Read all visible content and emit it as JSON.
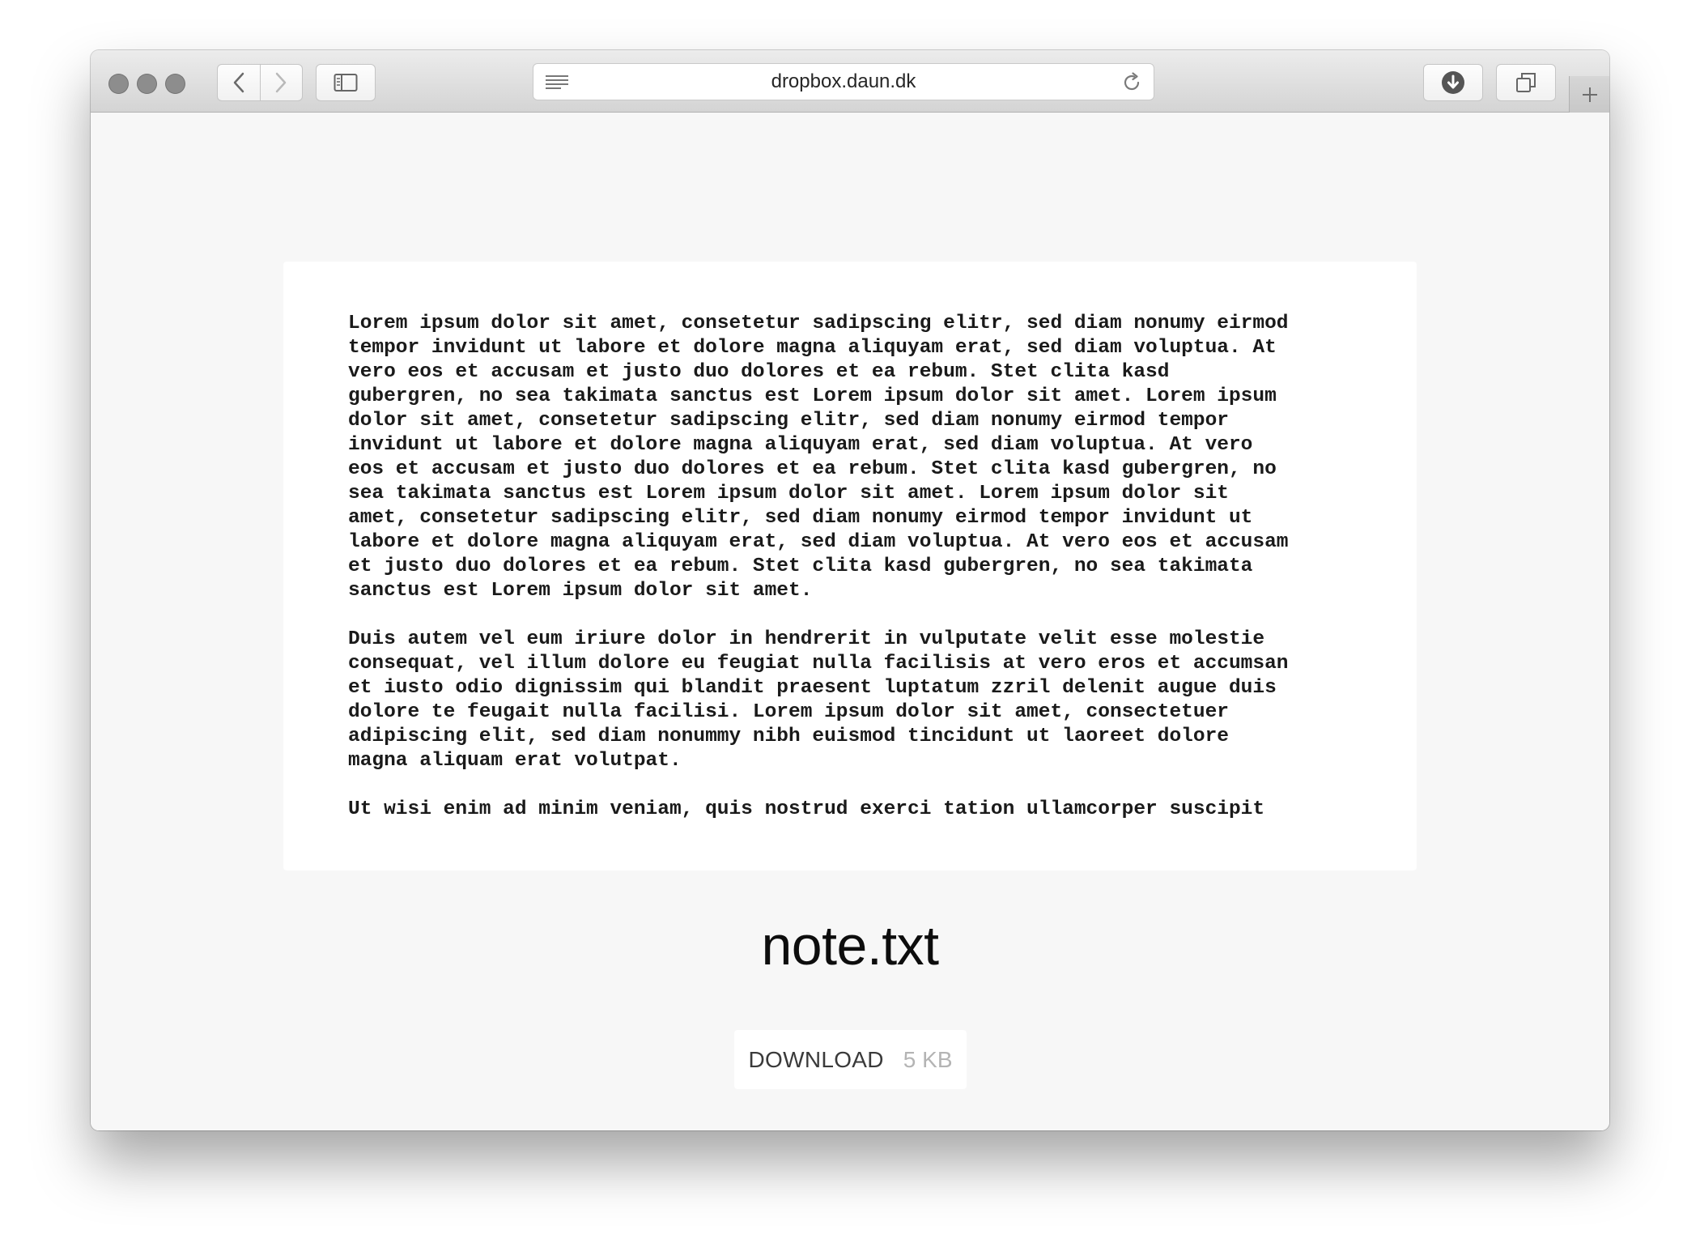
{
  "browser": {
    "url": "dropbox.daun.dk"
  },
  "document": {
    "paragraphs": [
      "Lorem ipsum dolor sit amet, consetetur sadipscing elitr, sed diam nonumy eirmod\ntempor invidunt ut labore et dolore magna aliquyam erat, sed diam voluptua. At\nvero eos et accusam et justo duo dolores et ea rebum. Stet clita kasd\ngubergren, no sea takimata sanctus est Lorem ipsum dolor sit amet. Lorem ipsum\ndolor sit amet, consetetur sadipscing elitr, sed diam nonumy eirmod tempor\ninvidunt ut labore et dolore magna aliquyam erat, sed diam voluptua. At vero\neos et accusam et justo duo dolores et ea rebum. Stet clita kasd gubergren, no\nsea takimata sanctus est Lorem ipsum dolor sit amet. Lorem ipsum dolor sit\namet, consetetur sadipscing elitr, sed diam nonumy eirmod tempor invidunt ut\nlabore et dolore magna aliquyam erat, sed diam voluptua. At vero eos et accusam\net justo duo dolores et ea rebum. Stet clita kasd gubergren, no sea takimata\nsanctus est Lorem ipsum dolor sit amet.",
      "Duis autem vel eum iriure dolor in hendrerit in vulputate velit esse molestie\nconsequat, vel illum dolore eu feugiat nulla facilisis at vero eros et accumsan\net iusto odio dignissim qui blandit praesent luptatum zzril delenit augue duis\ndolore te feugait nulla facilisi. Lorem ipsum dolor sit amet, consectetuer\nadipiscing elit, sed diam nonummy nibh euismod tincidunt ut laoreet dolore\nmagna aliquam erat volutpat.",
      "Ut wisi enim ad minim veniam, quis nostrud exerci tation ullamcorper suscipit"
    ]
  },
  "file": {
    "name": "note.txt",
    "download_label": "DOWNLOAD",
    "size": "5 KB"
  },
  "colors": {
    "page_background": "#f7f7f7",
    "card_background": "#ffffff",
    "traffic_light_inactive": "#8d8d8d",
    "size_text": "#b4b4b4"
  },
  "icons": {
    "toolbar": [
      "back-icon",
      "forward-icon",
      "sidebar-icon",
      "reader-icon",
      "reload-icon",
      "downloads-icon",
      "tabs-overview-icon",
      "plus-icon"
    ]
  }
}
